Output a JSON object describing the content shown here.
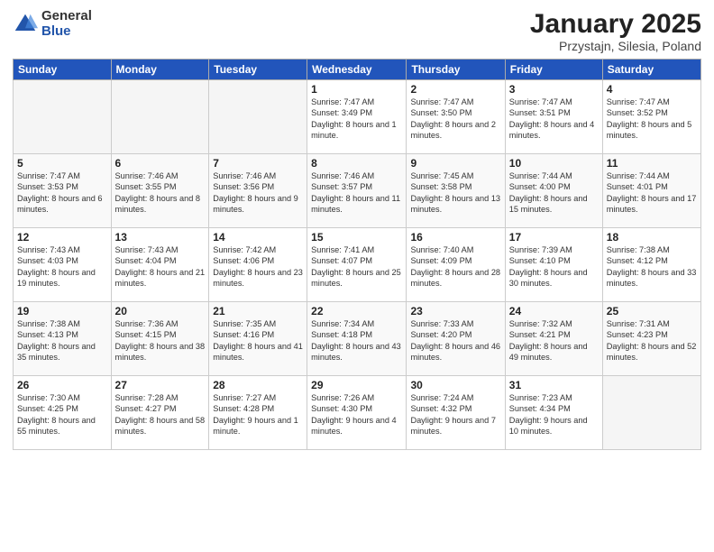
{
  "header": {
    "logo_general": "General",
    "logo_blue": "Blue",
    "title": "January 2025",
    "subtitle": "Przystajn, Silesia, Poland"
  },
  "days_of_week": [
    "Sunday",
    "Monday",
    "Tuesday",
    "Wednesday",
    "Thursday",
    "Friday",
    "Saturday"
  ],
  "weeks": [
    [
      {
        "day": "",
        "empty": true
      },
      {
        "day": "",
        "empty": true
      },
      {
        "day": "",
        "empty": true
      },
      {
        "day": "1",
        "sunrise": "7:47 AM",
        "sunset": "3:49 PM",
        "daylight": "8 hours and 1 minute."
      },
      {
        "day": "2",
        "sunrise": "7:47 AM",
        "sunset": "3:50 PM",
        "daylight": "8 hours and 2 minutes."
      },
      {
        "day": "3",
        "sunrise": "7:47 AM",
        "sunset": "3:51 PM",
        "daylight": "8 hours and 4 minutes."
      },
      {
        "day": "4",
        "sunrise": "7:47 AM",
        "sunset": "3:52 PM",
        "daylight": "8 hours and 5 minutes."
      }
    ],
    [
      {
        "day": "5",
        "sunrise": "7:47 AM",
        "sunset": "3:53 PM",
        "daylight": "8 hours and 6 minutes."
      },
      {
        "day": "6",
        "sunrise": "7:46 AM",
        "sunset": "3:55 PM",
        "daylight": "8 hours and 8 minutes."
      },
      {
        "day": "7",
        "sunrise": "7:46 AM",
        "sunset": "3:56 PM",
        "daylight": "8 hours and 9 minutes."
      },
      {
        "day": "8",
        "sunrise": "7:46 AM",
        "sunset": "3:57 PM",
        "daylight": "8 hours and 11 minutes."
      },
      {
        "day": "9",
        "sunrise": "7:45 AM",
        "sunset": "3:58 PM",
        "daylight": "8 hours and 13 minutes."
      },
      {
        "day": "10",
        "sunrise": "7:44 AM",
        "sunset": "4:00 PM",
        "daylight": "8 hours and 15 minutes."
      },
      {
        "day": "11",
        "sunrise": "7:44 AM",
        "sunset": "4:01 PM",
        "daylight": "8 hours and 17 minutes."
      }
    ],
    [
      {
        "day": "12",
        "sunrise": "7:43 AM",
        "sunset": "4:03 PM",
        "daylight": "8 hours and 19 minutes."
      },
      {
        "day": "13",
        "sunrise": "7:43 AM",
        "sunset": "4:04 PM",
        "daylight": "8 hours and 21 minutes."
      },
      {
        "day": "14",
        "sunrise": "7:42 AM",
        "sunset": "4:06 PM",
        "daylight": "8 hours and 23 minutes."
      },
      {
        "day": "15",
        "sunrise": "7:41 AM",
        "sunset": "4:07 PM",
        "daylight": "8 hours and 25 minutes."
      },
      {
        "day": "16",
        "sunrise": "7:40 AM",
        "sunset": "4:09 PM",
        "daylight": "8 hours and 28 minutes."
      },
      {
        "day": "17",
        "sunrise": "7:39 AM",
        "sunset": "4:10 PM",
        "daylight": "8 hours and 30 minutes."
      },
      {
        "day": "18",
        "sunrise": "7:38 AM",
        "sunset": "4:12 PM",
        "daylight": "8 hours and 33 minutes."
      }
    ],
    [
      {
        "day": "19",
        "sunrise": "7:38 AM",
        "sunset": "4:13 PM",
        "daylight": "8 hours and 35 minutes."
      },
      {
        "day": "20",
        "sunrise": "7:36 AM",
        "sunset": "4:15 PM",
        "daylight": "8 hours and 38 minutes."
      },
      {
        "day": "21",
        "sunrise": "7:35 AM",
        "sunset": "4:16 PM",
        "daylight": "8 hours and 41 minutes."
      },
      {
        "day": "22",
        "sunrise": "7:34 AM",
        "sunset": "4:18 PM",
        "daylight": "8 hours and 43 minutes."
      },
      {
        "day": "23",
        "sunrise": "7:33 AM",
        "sunset": "4:20 PM",
        "daylight": "8 hours and 46 minutes."
      },
      {
        "day": "24",
        "sunrise": "7:32 AM",
        "sunset": "4:21 PM",
        "daylight": "8 hours and 49 minutes."
      },
      {
        "day": "25",
        "sunrise": "7:31 AM",
        "sunset": "4:23 PM",
        "daylight": "8 hours and 52 minutes."
      }
    ],
    [
      {
        "day": "26",
        "sunrise": "7:30 AM",
        "sunset": "4:25 PM",
        "daylight": "8 hours and 55 minutes."
      },
      {
        "day": "27",
        "sunrise": "7:28 AM",
        "sunset": "4:27 PM",
        "daylight": "8 hours and 58 minutes."
      },
      {
        "day": "28",
        "sunrise": "7:27 AM",
        "sunset": "4:28 PM",
        "daylight": "9 hours and 1 minute."
      },
      {
        "day": "29",
        "sunrise": "7:26 AM",
        "sunset": "4:30 PM",
        "daylight": "9 hours and 4 minutes."
      },
      {
        "day": "30",
        "sunrise": "7:24 AM",
        "sunset": "4:32 PM",
        "daylight": "9 hours and 7 minutes."
      },
      {
        "day": "31",
        "sunrise": "7:23 AM",
        "sunset": "4:34 PM",
        "daylight": "9 hours and 10 minutes."
      },
      {
        "day": "",
        "empty": true
      }
    ]
  ]
}
